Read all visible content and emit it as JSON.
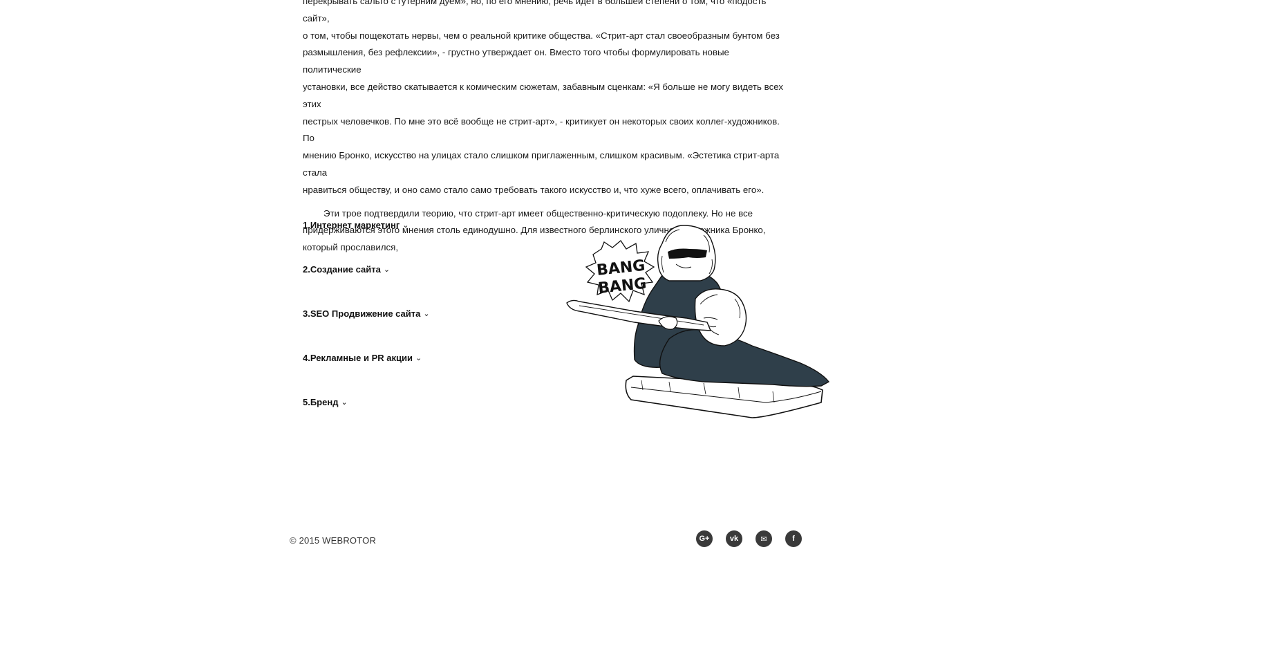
{
  "article": {
    "paragraph_1_lines": [
      "перекрывать сальто с гутерним дуем», но, по его мнению, речь идет в большей степени о том, что «подость сайт»,",
      "о том, чтобы пощекотать нервы, чем о реальной критике общества. «Стрит-арт стал своеобразным бунтом без",
      "размышления, без рефлексии», - грустно утверждает он. Вместо того чтобы формулировать новые политические",
      "установки, все действо скатывается к комическим сюжетам, забавным сценкам: «Я больше не могу видеть всех этих",
      "пестрых человечков. По мне это всё вообще не стрит-арт», - критикует он некоторых своих коллег-художников. По",
      "мнению Бронко, искусство на улицах стало слишком приглаженным, слишком красивым. «Эстетика стрит-арта стала",
      "нравиться обществу, и оно само стало само требовать такого искусство и, что хуже всего, оплачивать его»."
    ],
    "paragraph_2_lines": [
      "Эти трое подтвердили теорию, что стрит-арт имеет общественно-критическую подоплеку. Но не все",
      "придерживаются этого мнения столь единодушно. Для известного берлинского уличного художника Бронко,",
      "который прославился,"
    ]
  },
  "accordion": {
    "items": [
      {
        "label": "1.Интернет маркетинг"
      },
      {
        "label": "2.Создание сайта"
      },
      {
        "label": "3.SEO Продвижение сайта"
      },
      {
        "label": "4.Рекламные и PR акции"
      },
      {
        "label": "5.Бренд"
      }
    ],
    "chevron_icon": "chevron-down-icon"
  },
  "illustration": {
    "bubble_text_1": "BANG",
    "bubble_text_2": "BANG",
    "fill_color": "#2f3f4a"
  },
  "footer": {
    "copyright": "© 2015 WEBROTOR",
    "social": [
      {
        "icon": "google-plus-icon",
        "glyph": "G+"
      },
      {
        "icon": "vk-icon",
        "glyph": "vk"
      },
      {
        "icon": "mail-icon",
        "glyph": "✉"
      },
      {
        "icon": "facebook-icon",
        "glyph": "f"
      }
    ],
    "social_bg_color": "#3a3a3a"
  }
}
